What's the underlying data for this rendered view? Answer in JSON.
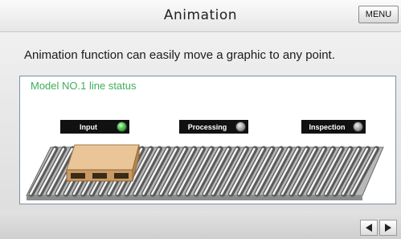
{
  "header": {
    "title": "Animation",
    "menu_label": "MENU"
  },
  "description": "Animation function can easily move a graphic to any point.",
  "panel": {
    "title": "Model NO.1 line status",
    "stations": [
      {
        "label": "Input",
        "state": "on"
      },
      {
        "label": "Processing",
        "state": "off"
      },
      {
        "label": "Inspection",
        "state": "off"
      }
    ]
  },
  "nav": {
    "prev_icon": "triangle-left-icon",
    "next_icon": "triangle-right-icon"
  },
  "colors": {
    "panel_title": "#3fae5b",
    "lamp_on": "#4cc44c",
    "lamp_off": "#9a9a9a",
    "pallet": "#e2b98a"
  }
}
